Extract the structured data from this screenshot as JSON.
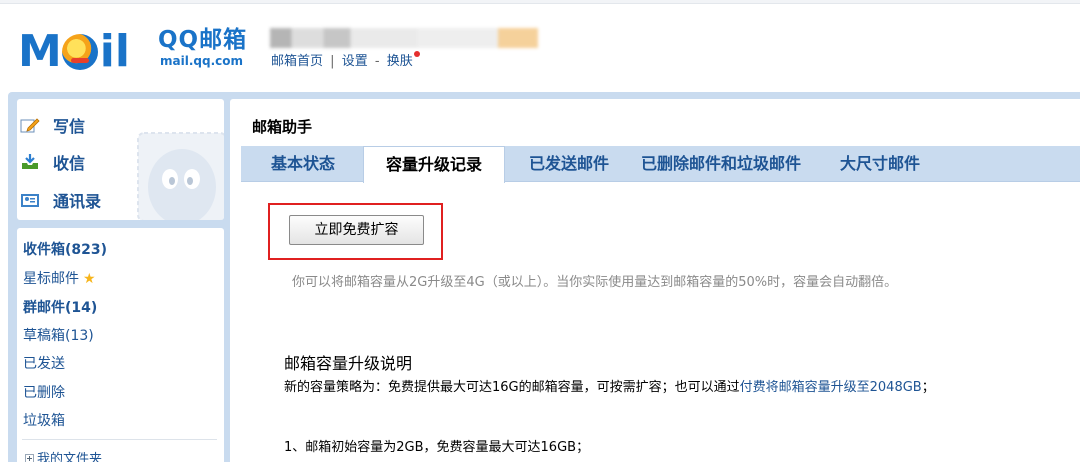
{
  "brand": {
    "logo_text": "Mail",
    "title_cn": "QQ邮箱",
    "title_en": "mail.qq.com"
  },
  "header": {
    "links": [
      "邮箱首页",
      "设置",
      "换肤"
    ],
    "separators": [
      "|",
      "-"
    ]
  },
  "nav": {
    "compose": "写信",
    "inbox": "收信",
    "contacts": "通讯录"
  },
  "folders": [
    {
      "label": "收件箱(823)",
      "bold": true
    },
    {
      "label": "星标邮件",
      "bold": false,
      "starred": true
    },
    {
      "label": "群邮件(14)",
      "bold": true
    },
    {
      "label": "草稿箱(13)",
      "bold": false
    },
    {
      "label": "已发送",
      "bold": false
    },
    {
      "label": "已删除",
      "bold": false
    },
    {
      "label": "垃圾箱",
      "bold": false
    }
  ],
  "my_folders": "我的文件夹",
  "main": {
    "title": "邮箱助手",
    "tabs": [
      {
        "label": "基本状态",
        "active": false
      },
      {
        "label": "容量升级记录",
        "active": true
      },
      {
        "label": "已发送邮件",
        "active": false
      },
      {
        "label": "已删除邮件和垃圾邮件",
        "active": false
      },
      {
        "label": "大尺寸邮件",
        "active": false
      }
    ],
    "expand_button": "立即免费扩容",
    "hint": "你可以将邮箱容量从2G升级至4G（或以上）。当你实际使用量达到邮箱容量的50%时，容量会自动翻倍。",
    "section_title": "邮箱容量升级说明",
    "policy_prefix": "新的容量策略为：免费提供最大可达16G的邮箱容量，可按需扩容；也可以通过",
    "policy_link": "付费将邮箱容量升级至2048GB",
    "policy_suffix": "；",
    "item1": "1、邮箱初始容量为2GB，免费容量最大可达16GB；"
  },
  "colors": {
    "brand_blue": "#1a73c8",
    "link_blue": "#1e5494",
    "frame_blue": "#c9dbef",
    "highlight_red": "#e02020"
  }
}
